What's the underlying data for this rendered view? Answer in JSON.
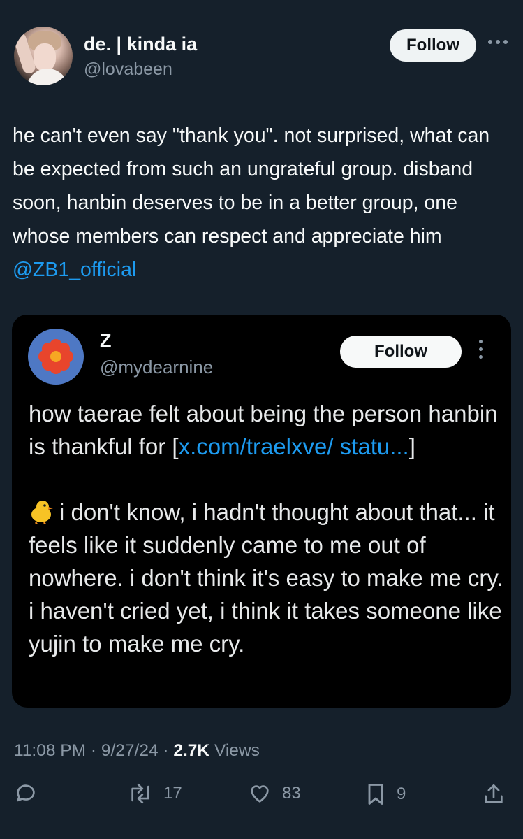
{
  "author": {
    "display_name": "de. | kinda ia",
    "handle": "@lovabeen",
    "follow_label": "Follow",
    "avatar_icon": "profile-photo"
  },
  "tweet": {
    "text": "he can't even say \"thank you\". not surprised, what can be expected from such an ungrateful group. disband soon, hanbin deserves to be in a better group, one whose members can respect and appreciate him ",
    "mention": "@ZB1_official"
  },
  "quote": {
    "display_name": "Z",
    "handle": "@mydearnine",
    "follow_label": "Follow",
    "avatar_icon": "red-flower-icon",
    "text_intro": "how taerae felt about being the person hanbin is thankful for [",
    "link_text": "x.com/traelxve/ statu...",
    "text_link_close": "]",
    "emoji_icon": "baby-chick-icon",
    "body": "i don't know, i hadn't thought about that... it feels like it suddenly came to me out of nowhere. i don't think it's easy to make me cry. i haven't cried yet, i think it takes someone like yujin to make me cry."
  },
  "meta": {
    "time": "11:08 PM",
    "sep1": " · ",
    "date": "9/27/24",
    "sep2": " · ",
    "views_count": "2.7K",
    "views_label": " Views"
  },
  "actions": {
    "reply_icon": "reply-icon",
    "retweet_icon": "retweet-icon",
    "retweet_count": "17",
    "like_icon": "heart-icon",
    "like_count": "83",
    "bookmark_icon": "bookmark-icon",
    "bookmark_count": "9",
    "share_icon": "share-icon"
  },
  "colors": {
    "background": "#15202b",
    "quote_background": "#000000",
    "accent": "#1d9bf0",
    "muted": "#8b98a5"
  }
}
